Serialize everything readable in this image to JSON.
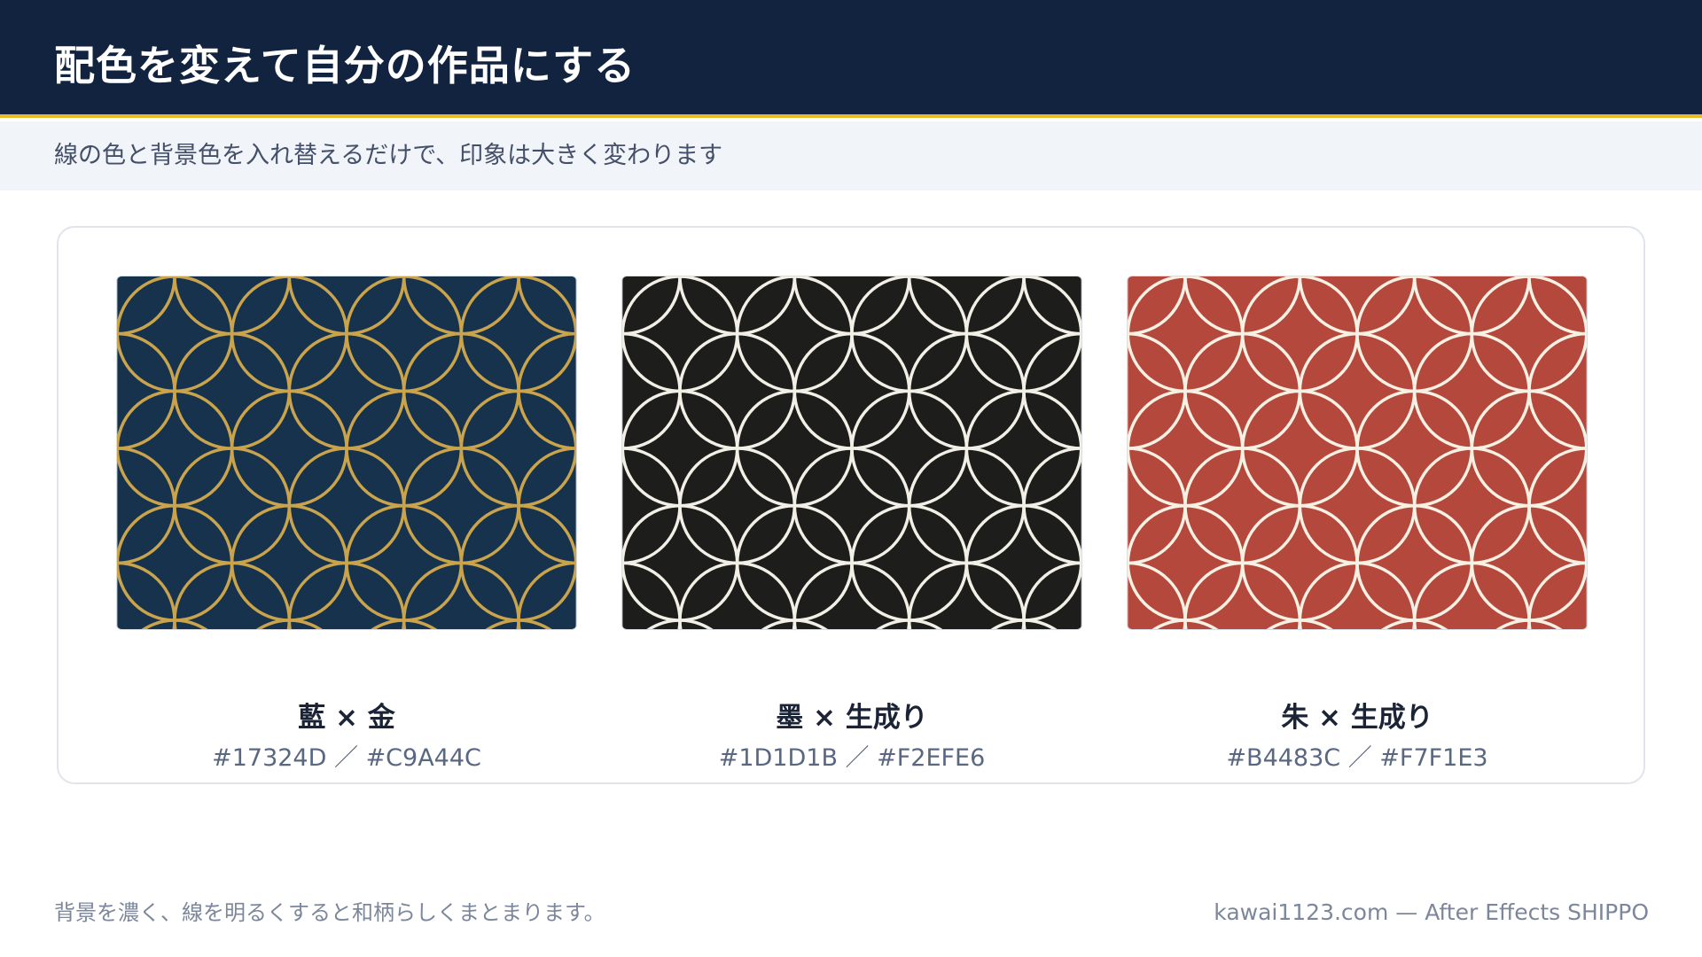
{
  "header": {
    "title": "配色を変えて自分の作品にする"
  },
  "subtitle": "線の色と背景色を入れ替えるだけで、印象は大きく変わります",
  "swatches": [
    {
      "name": "藍 × 金",
      "hex_label": "#17324D ／ #C9A44C",
      "background": "#17324D",
      "line": "#C9A44C"
    },
    {
      "name": "墨 × 生成り",
      "hex_label": "#1D1D1B ／ #F2EFE6",
      "background": "#1D1D1B",
      "line": "#F2EFE6"
    },
    {
      "name": "朱 × 生成り",
      "hex_label": "#B4483C ／ #F7F1E3",
      "background": "#B4483C",
      "line": "#F7F1E3"
    }
  ],
  "footer": {
    "note": "背景を濃く、線を明るくすると和柄らしくまとまります。",
    "credit": "kawai1123.com — After Effects SHIPPO"
  },
  "colors": {
    "header_bg": "#11233F",
    "accent_line": "#E8B828",
    "subtitle_band": "#F1F4F9"
  }
}
